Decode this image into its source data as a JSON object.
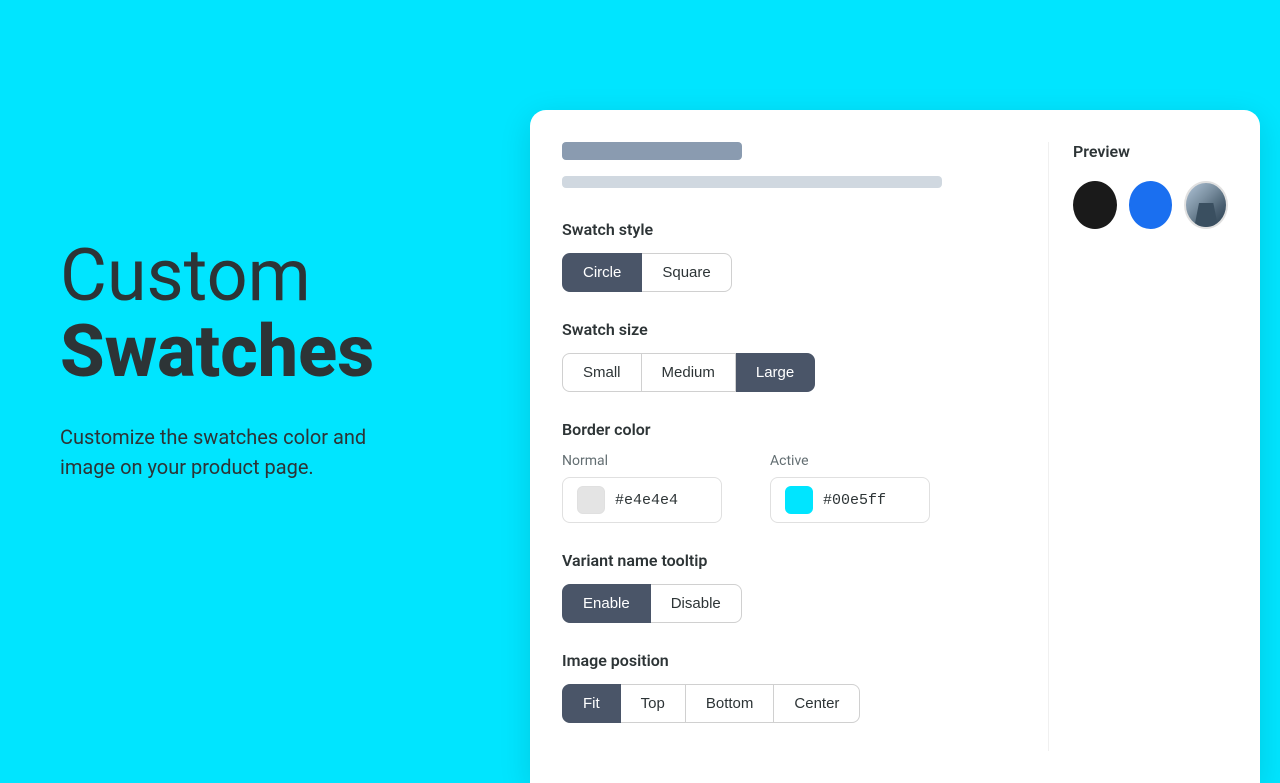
{
  "background_color": "#00e5ff",
  "hero": {
    "title_light": "Custom",
    "title_bold": "Swatches",
    "subtitle": "Customize the swatches color and\nimage on your product page."
  },
  "card": {
    "skeleton_title": "",
    "skeleton_sub": "",
    "swatch_style": {
      "label": "Swatch style",
      "options": [
        "Circle",
        "Square"
      ],
      "active": "Circle"
    },
    "swatch_size": {
      "label": "Swatch size",
      "options": [
        "Small",
        "Medium",
        "Large"
      ],
      "active": "Large"
    },
    "border_color": {
      "label": "Border color",
      "normal": {
        "label": "Normal",
        "value": "#e4e4e4",
        "color": "#e4e4e4"
      },
      "active": {
        "label": "Active",
        "value": "#00e5ff",
        "color": "#00e5ff"
      }
    },
    "variant_tooltip": {
      "label": "Variant name tooltip",
      "options": [
        "Enable",
        "Disable"
      ],
      "active": "Enable"
    },
    "image_position": {
      "label": "Image position",
      "options": [
        "Fit",
        "Top",
        "Bottom",
        "Center"
      ],
      "active": "Fit"
    }
  },
  "preview": {
    "label": "Preview",
    "swatches": [
      {
        "color": "black",
        "label": "Black"
      },
      {
        "color": "blue",
        "label": "Blue"
      },
      {
        "color": "image",
        "label": "Image"
      }
    ]
  }
}
